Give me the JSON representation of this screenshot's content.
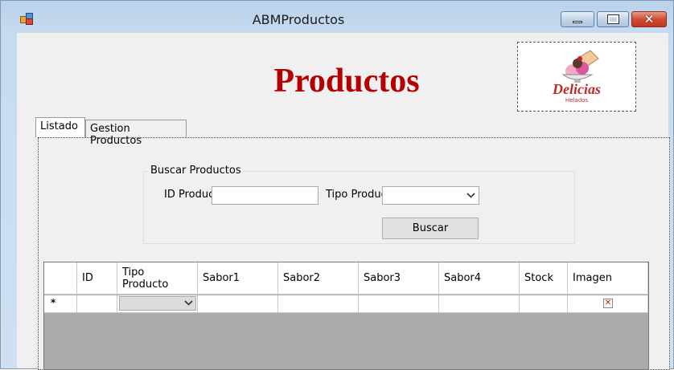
{
  "window": {
    "title": "ABMProductos",
    "icon": "app-window-icon",
    "controls": {
      "minimize_icon": "minimize-icon",
      "maximize_icon": "maximize-icon",
      "close_icon": "close-icon",
      "close_glyph": "✕"
    }
  },
  "header": {
    "heading": "Productos",
    "heading_color": "#b40000",
    "logo": {
      "word": "Delicias",
      "sub": "Helados",
      "color": "#c0282e"
    }
  },
  "tabs": [
    {
      "label": "Listado",
      "active": true
    },
    {
      "label": "Gestion Productos",
      "active": false
    }
  ],
  "search": {
    "group_title": "Buscar Productos",
    "id_label": "ID Producto",
    "id_value": "",
    "tipo_label": "Tipo Producto",
    "tipo_selected": "",
    "dropdown_icon": "chevron-down-icon",
    "button_label": "Buscar"
  },
  "grid": {
    "columns": [
      "ID",
      "Tipo\nProducto",
      "Sabor1",
      "Sabor2",
      "Sabor3",
      "Sabor4",
      "Stock",
      "Imagen"
    ],
    "new_row_marker": "*",
    "new_row": {
      "id": "",
      "tipo": "",
      "sabor1": "",
      "sabor2": "",
      "sabor3": "",
      "sabor4": "",
      "stock": "",
      "imagen": ""
    },
    "broken_image_glyph": "✕"
  }
}
